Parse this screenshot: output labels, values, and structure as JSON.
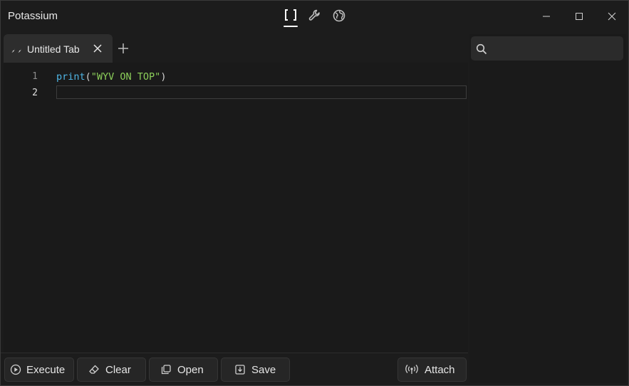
{
  "app": {
    "title": "Potassium"
  },
  "top_icons": [
    "editor-brackets-icon",
    "wrench-icon",
    "globe-icon"
  ],
  "tabs": [
    {
      "label": "Untitled Tab"
    }
  ],
  "editor": {
    "lines": [
      {
        "num": "1",
        "tokens": [
          {
            "t": "print",
            "k": "fn"
          },
          {
            "t": "(",
            "k": "punc"
          },
          {
            "t": "\"WYV ON TOP\"",
            "k": "str"
          },
          {
            "t": ")",
            "k": "punc"
          }
        ]
      },
      {
        "num": "2",
        "tokens": []
      }
    ]
  },
  "search": {
    "value": "",
    "placeholder": ""
  },
  "buttons": {
    "execute": "Execute",
    "clear": "Clear",
    "open": "Open",
    "save": "Save",
    "attach": "Attach"
  },
  "colors": {
    "background": "#1c1c1c",
    "panel": "#2d2d2d",
    "fn": "#4fb6e6",
    "string": "#8ccf5a"
  }
}
